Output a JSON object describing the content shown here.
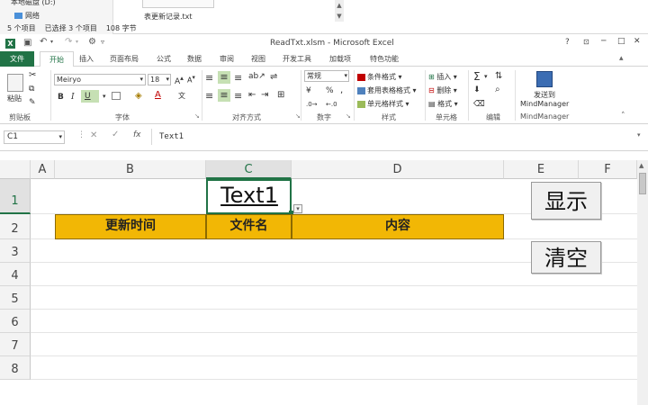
{
  "explorer": {
    "nav_item_1": "本地磁盘 (D:)",
    "nav_item_2": "网络",
    "status_items": "5 个项目",
    "status_selected": "已选择 3 个项目",
    "status_size": "108 字节",
    "file_name": "表更新记录.txt"
  },
  "window": {
    "title": "ReadTxt.xlsm - Microsoft Excel",
    "help": "?",
    "minimize": "─",
    "restore": "□",
    "close": "✕"
  },
  "tabs": [
    "文件",
    "开始",
    "插入",
    "页面布局",
    "公式",
    "数据",
    "审阅",
    "视图",
    "开发工具",
    "加载项",
    "特色功能"
  ],
  "ribbon": {
    "groups": [
      "剪贴板",
      "字体",
      "对齐方式",
      "数字",
      "样式",
      "单元格",
      "编辑",
      "MindManager"
    ],
    "paste": "粘贴",
    "font_name": "Meiryo",
    "font_size": "18",
    "bold": "B",
    "italic": "I",
    "underline": "U",
    "number_format": "常规",
    "percent": "%",
    "comma": ",",
    "cond_format": "条件格式",
    "table_format": "套用表格格式",
    "cell_style": "单元格样式",
    "insert": "插入",
    "delete": "删除",
    "format": "格式",
    "sum": "Σ",
    "send_to": "发送到",
    "mindmanager": "MindManager"
  },
  "formula": {
    "name_box": "C1",
    "fx": "fx",
    "content": "Text1"
  },
  "sheet": {
    "columns": [
      "A",
      "B",
      "C",
      "D",
      "E",
      "F"
    ],
    "rows": [
      "1",
      "2",
      "3",
      "4",
      "5",
      "6",
      "7",
      "8"
    ],
    "textbox": "Text1",
    "headers": [
      "更新时间",
      "文件名",
      "内容"
    ],
    "button_show": "显示",
    "button_clear": "清空"
  },
  "colors": {
    "excel_green": "#217346",
    "header_fill": "#f2b705"
  }
}
